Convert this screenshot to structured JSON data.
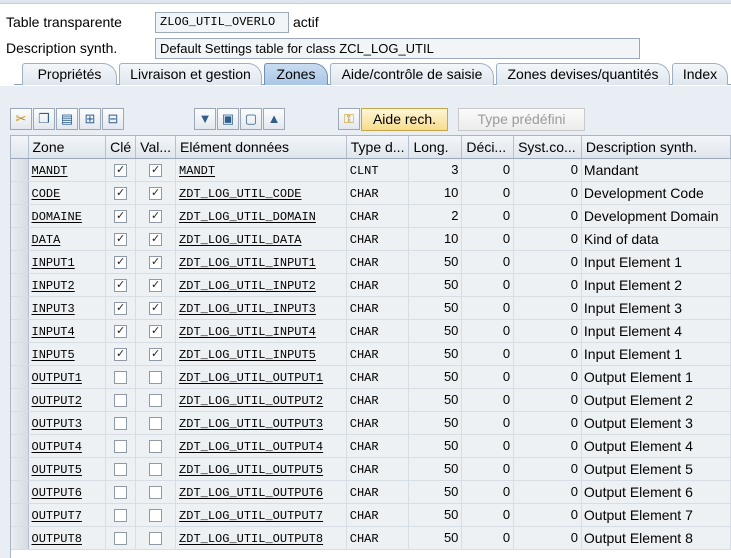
{
  "header": {
    "table_label": "Table transparente",
    "table_name": "ZLOG_UTIL_OVERLO",
    "status": "actif",
    "desc_label": "Description synth.",
    "desc_value": "Default Settings table for class ZCL_LOG_UTIL"
  },
  "tabs": [
    {
      "label": "Propriétés",
      "active": false
    },
    {
      "label": "Livraison et gestion",
      "active": false
    },
    {
      "label": "Zones",
      "active": true
    },
    {
      "label": "Aide/contrôle de saisie",
      "active": false
    },
    {
      "label": "Zones devises/quantités",
      "active": false
    },
    {
      "label": "Index",
      "active": false
    }
  ],
  "toolbar": {
    "icons": [
      "cut-icon",
      "copy-icon",
      "paste-icon",
      "insert-row-icon",
      "delete-row-icon",
      "filter-icon",
      "select-all-icon",
      "deselect-icon",
      "sort-icon",
      "key-icon"
    ],
    "search_help_button": "Aide rech.",
    "predefined_type_button": "Type prédéfini"
  },
  "columns": [
    "Zone",
    "Clé",
    "Val...",
    "Elément données",
    "Type d...",
    "Long.",
    "Déci...",
    "Syst.co...",
    "Description synth."
  ],
  "rows": [
    {
      "zone": "MANDT",
      "key": true,
      "val": true,
      "element": "MANDT",
      "type": "CLNT",
      "length": "3",
      "decimals": "0",
      "syst": "0",
      "desc": "Mandant"
    },
    {
      "zone": "CODE",
      "key": true,
      "val": true,
      "element": "ZDT_LOG_UTIL_CODE",
      "type": "CHAR",
      "length": "10",
      "decimals": "0",
      "syst": "0",
      "desc": "Development Code"
    },
    {
      "zone": "DOMAINE",
      "key": true,
      "val": true,
      "element": "ZDT_LOG_UTIL_DOMAIN",
      "type": "CHAR",
      "length": "2",
      "decimals": "0",
      "syst": "0",
      "desc": "Development Domain"
    },
    {
      "zone": "DATA",
      "key": true,
      "val": true,
      "element": "ZDT_LOG_UTIL_DATA",
      "type": "CHAR",
      "length": "10",
      "decimals": "0",
      "syst": "0",
      "desc": "Kind of data"
    },
    {
      "zone": "INPUT1",
      "key": true,
      "val": true,
      "element": "ZDT_LOG_UTIL_INPUT1",
      "type": "CHAR",
      "length": "50",
      "decimals": "0",
      "syst": "0",
      "desc": "Input Element 1"
    },
    {
      "zone": "INPUT2",
      "key": true,
      "val": true,
      "element": "ZDT_LOG_UTIL_INPUT2",
      "type": "CHAR",
      "length": "50",
      "decimals": "0",
      "syst": "0",
      "desc": "Input Element 2"
    },
    {
      "zone": "INPUT3",
      "key": true,
      "val": true,
      "element": "ZDT_LOG_UTIL_INPUT3",
      "type": "CHAR",
      "length": "50",
      "decimals": "0",
      "syst": "0",
      "desc": "Input Element 3"
    },
    {
      "zone": "INPUT4",
      "key": true,
      "val": true,
      "element": "ZDT_LOG_UTIL_INPUT4",
      "type": "CHAR",
      "length": "50",
      "decimals": "0",
      "syst": "0",
      "desc": "Input Element 4"
    },
    {
      "zone": "INPUT5",
      "key": true,
      "val": true,
      "element": "ZDT_LOG_UTIL_INPUT5",
      "type": "CHAR",
      "length": "50",
      "decimals": "0",
      "syst": "0",
      "desc": "Input Element 1"
    },
    {
      "zone": "OUTPUT1",
      "key": false,
      "val": false,
      "element": "ZDT_LOG_UTIL_OUTPUT1",
      "type": "CHAR",
      "length": "50",
      "decimals": "0",
      "syst": "0",
      "desc": "Output Element 1"
    },
    {
      "zone": "OUTPUT2",
      "key": false,
      "val": false,
      "element": "ZDT_LOG_UTIL_OUTPUT2",
      "type": "CHAR",
      "length": "50",
      "decimals": "0",
      "syst": "0",
      "desc": "Output Element 2"
    },
    {
      "zone": "OUTPUT3",
      "key": false,
      "val": false,
      "element": "ZDT_LOG_UTIL_OUTPUT3",
      "type": "CHAR",
      "length": "50",
      "decimals": "0",
      "syst": "0",
      "desc": "Output Element 3"
    },
    {
      "zone": "OUTPUT4",
      "key": false,
      "val": false,
      "element": "ZDT_LOG_UTIL_OUTPUT4",
      "type": "CHAR",
      "length": "50",
      "decimals": "0",
      "syst": "0",
      "desc": "Output Element 4"
    },
    {
      "zone": "OUTPUT5",
      "key": false,
      "val": false,
      "element": "ZDT_LOG_UTIL_OUTPUT5",
      "type": "CHAR",
      "length": "50",
      "decimals": "0",
      "syst": "0",
      "desc": "Output Element 5"
    },
    {
      "zone": "OUTPUT6",
      "key": false,
      "val": false,
      "element": "ZDT_LOG_UTIL_OUTPUT6",
      "type": "CHAR",
      "length": "50",
      "decimals": "0",
      "syst": "0",
      "desc": "Output Element 6"
    },
    {
      "zone": "OUTPUT7",
      "key": false,
      "val": false,
      "element": "ZDT_LOG_UTIL_OUTPUT7",
      "type": "CHAR",
      "length": "50",
      "decimals": "0",
      "syst": "0",
      "desc": "Output Element 7"
    },
    {
      "zone": "OUTPUT8",
      "key": false,
      "val": false,
      "element": "ZDT_LOG_UTIL_OUTPUT8",
      "type": "CHAR",
      "length": "50",
      "decimals": "0",
      "syst": "0",
      "desc": "Output Element 8"
    }
  ]
}
